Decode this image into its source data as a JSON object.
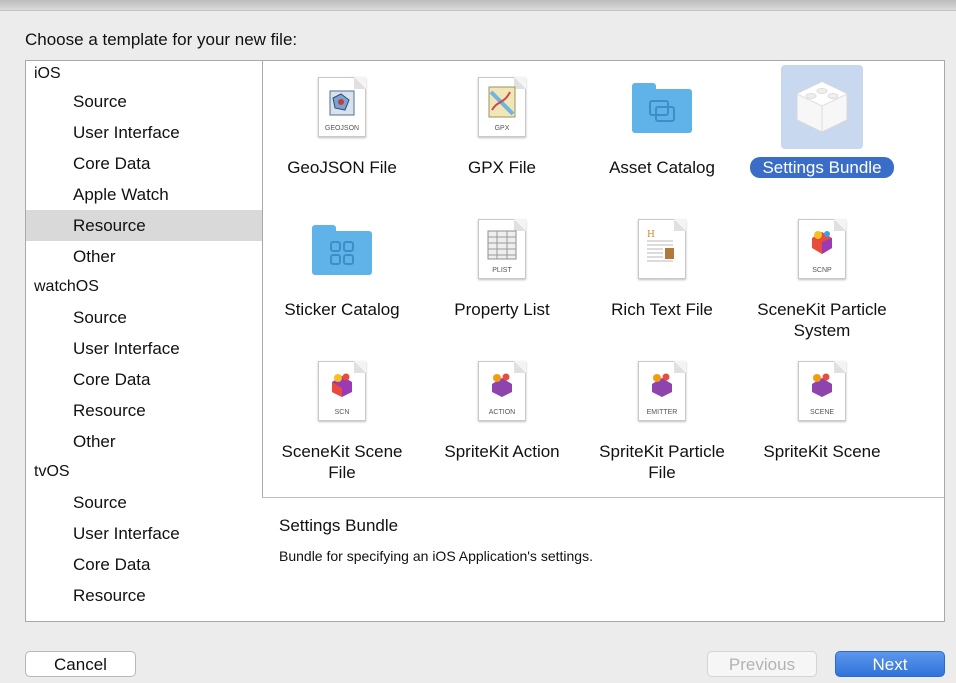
{
  "heading": "Choose a template for your new file:",
  "sidebar": {
    "sections": [
      {
        "title": "iOS",
        "items": [
          "Source",
          "User Interface",
          "Core Data",
          "Apple Watch",
          "Resource",
          "Other"
        ]
      },
      {
        "title": "watchOS",
        "items": [
          "Source",
          "User Interface",
          "Core Data",
          "Resource",
          "Other"
        ]
      },
      {
        "title": "tvOS",
        "items": [
          "Source",
          "User Interface",
          "Core Data",
          "Resource"
        ]
      }
    ],
    "selected": "Resource"
  },
  "templates": [
    {
      "label": "GeoJSON File",
      "icon": "geojson-doc-icon",
      "icon_caption": "GEOJSON"
    },
    {
      "label": "GPX File",
      "icon": "gpx-doc-icon",
      "icon_caption": "GPX"
    },
    {
      "label": "Asset Catalog",
      "icon": "asset-catalog-folder-icon"
    },
    {
      "label": "Settings Bundle",
      "icon": "settings-bundle-cube-icon",
      "selected": true
    },
    {
      "label": "Sticker Catalog",
      "icon": "sticker-catalog-folder-icon"
    },
    {
      "label": "Property List",
      "icon": "plist-doc-icon",
      "icon_caption": "PLIST"
    },
    {
      "label": "Rich Text File",
      "icon": "rich-text-doc-icon"
    },
    {
      "label": "SceneKit Particle System",
      "icon": "scenekit-particle-doc-icon",
      "icon_caption": "SCNP"
    },
    {
      "label": "SceneKit Scene File",
      "icon": "scenekit-scene-doc-icon",
      "icon_caption": "SCN"
    },
    {
      "label": "SpriteKit Action",
      "icon": "spritekit-action-doc-icon",
      "icon_caption": "ACTION"
    },
    {
      "label": "SpriteKit Particle File",
      "icon": "spritekit-particle-doc-icon",
      "icon_caption": "EMITTER"
    },
    {
      "label": "SpriteKit Scene",
      "icon": "spritekit-scene-doc-icon",
      "icon_caption": "SCENE"
    }
  ],
  "description": {
    "title": "Settings Bundle",
    "text": "Bundle for specifying an iOS Application's settings."
  },
  "buttons": {
    "cancel": "Cancel",
    "previous": "Previous",
    "next": "Next"
  },
  "colors": {
    "selection": "#3a6dc8",
    "sidebar_selection": "#d9d9d9",
    "folder": "#5fb3e8",
    "next_button": "#3b7ddd"
  }
}
